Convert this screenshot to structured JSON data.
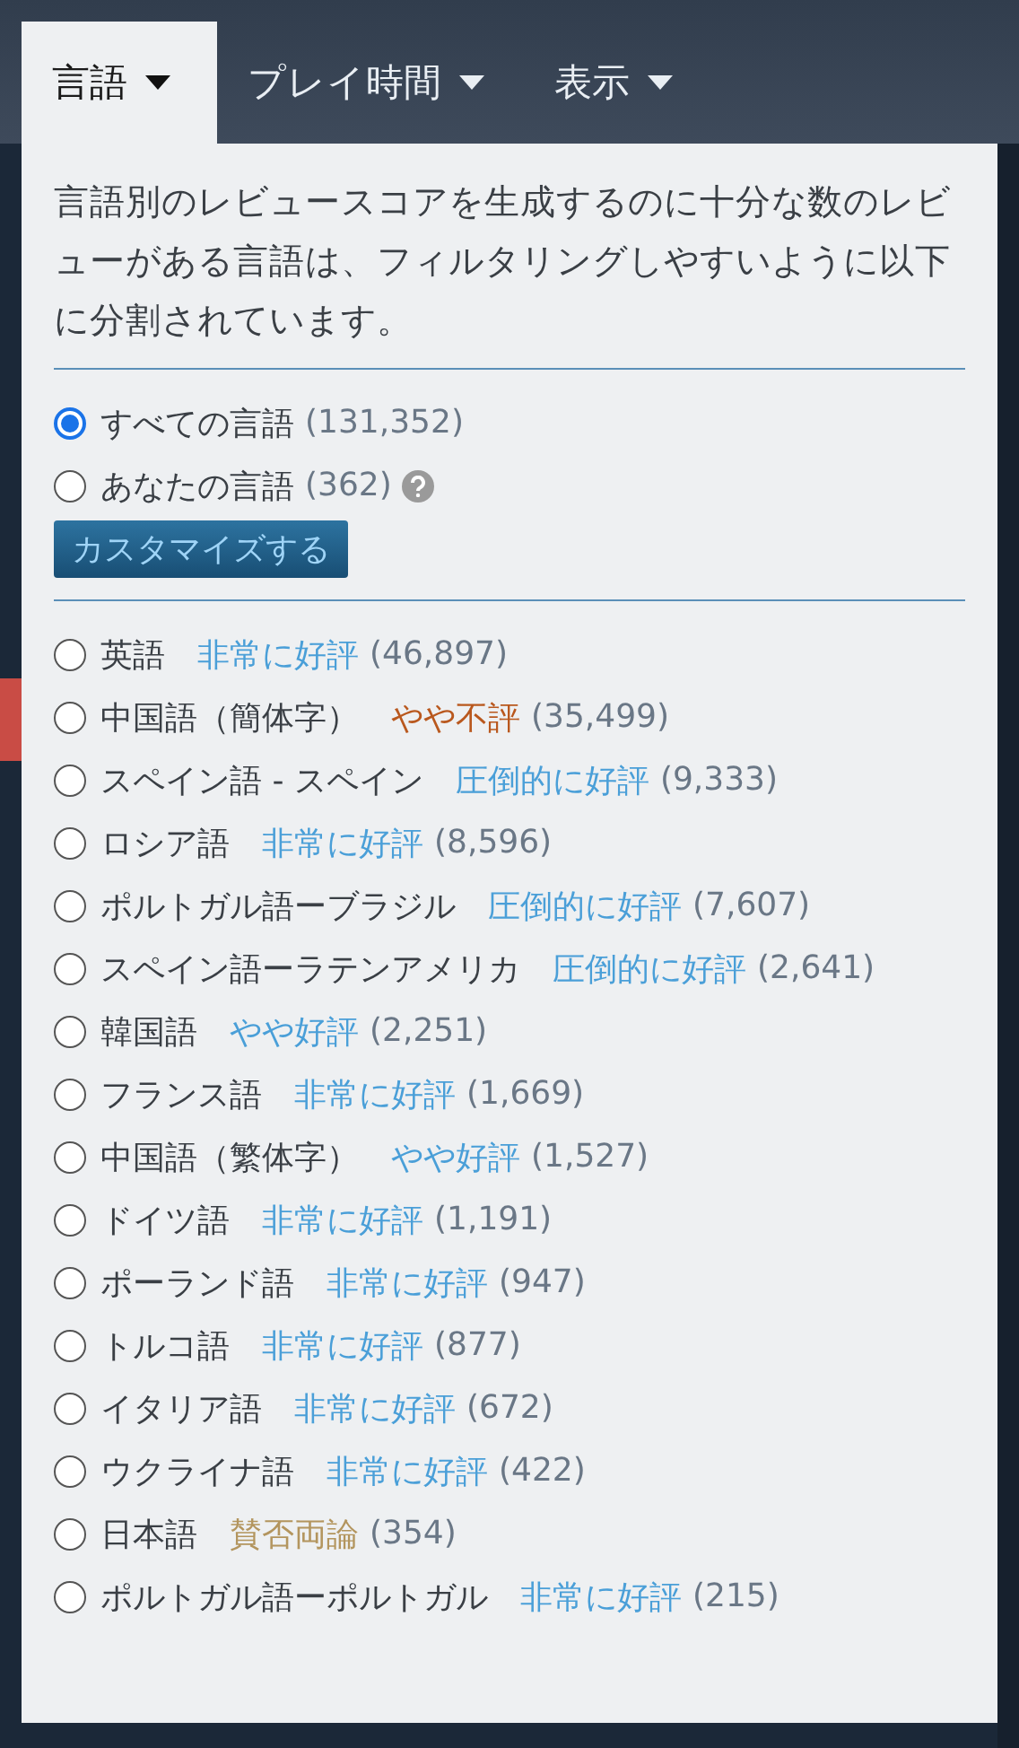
{
  "tabs": [
    {
      "label": "言語",
      "selected": true
    },
    {
      "label": "プレイ時間",
      "selected": false
    },
    {
      "label": "表示",
      "selected": false
    }
  ],
  "description": "言語別のレビュースコアを生成するのに十分な数のレビューがある言語は、フィルタリングしやすいように以下に分割されています。",
  "scopes": [
    {
      "label": "すべての言語",
      "count": "(131,352)",
      "selected": true,
      "help": false
    },
    {
      "label": "あなたの言語",
      "count": "(362)",
      "selected": false,
      "help": true
    }
  ],
  "customize_button": "カスタマイズする",
  "languages": [
    {
      "name": "英語",
      "rating": "非常に好評",
      "color": "#4a9fd8",
      "count": "(46,897)",
      "selected": false
    },
    {
      "name": "中国語（簡体字）",
      "rating": "やや不評",
      "color": "#b9581e",
      "count": "(35,499)",
      "selected": false
    },
    {
      "name": "スペイン語 - スペイン",
      "rating": "圧倒的に好評",
      "color": "#4a9fd8",
      "count": "(9,333)",
      "selected": false
    },
    {
      "name": "ロシア語",
      "rating": "非常に好評",
      "color": "#4a9fd8",
      "count": "(8,596)",
      "selected": false
    },
    {
      "name": "ポルトガル語ーブラジル",
      "rating": "圧倒的に好評",
      "color": "#4a9fd8",
      "count": "(7,607)",
      "selected": false
    },
    {
      "name": "スペイン語ーラテンアメリカ",
      "rating": "圧倒的に好評",
      "color": "#4a9fd8",
      "count": "(2,641)",
      "selected": false
    },
    {
      "name": "韓国語",
      "rating": "やや好評",
      "color": "#4a9fd8",
      "count": "(2,251)",
      "selected": false
    },
    {
      "name": "フランス語",
      "rating": "非常に好評",
      "color": "#4a9fd8",
      "count": "(1,669)",
      "selected": false
    },
    {
      "name": "中国語（繁体字）",
      "rating": "やや好評",
      "color": "#4a9fd8",
      "count": "(1,527)",
      "selected": false
    },
    {
      "name": "ドイツ語",
      "rating": "非常に好評",
      "color": "#4a9fd8",
      "count": "(1,191)",
      "selected": false
    },
    {
      "name": "ポーランド語",
      "rating": "非常に好評",
      "color": "#4a9fd8",
      "count": "(947)",
      "selected": false
    },
    {
      "name": "トルコ語",
      "rating": "非常に好評",
      "color": "#4a9fd8",
      "count": "(877)",
      "selected": false
    },
    {
      "name": "イタリア語",
      "rating": "非常に好評",
      "color": "#4a9fd8",
      "count": "(672)",
      "selected": false
    },
    {
      "name": "ウクライナ語",
      "rating": "非常に好評",
      "color": "#4a9fd8",
      "count": "(422)",
      "selected": false
    },
    {
      "name": "日本語",
      "rating": "賛否両論",
      "color": "#b3955e",
      "count": "(354)",
      "selected": false
    },
    {
      "name": "ポルトガル語ーポルトガル",
      "rating": "非常に好評",
      "color": "#4a9fd8",
      "count": "(215)",
      "selected": false
    }
  ]
}
